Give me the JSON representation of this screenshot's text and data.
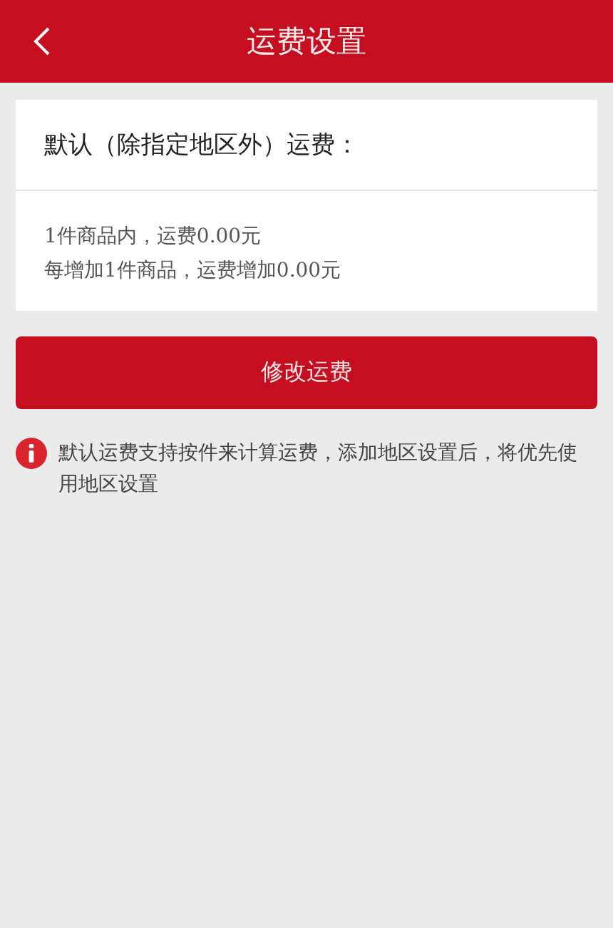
{
  "header": {
    "title": "运费设置"
  },
  "card": {
    "heading": "默认（除指定地区外）运费：",
    "lines": [
      "1件商品内，运费0.00元",
      "每增加1件商品，运费增加0.00元"
    ]
  },
  "button": "修改运费",
  "notice": "默认运费支持按件来计算运费，添加地区设置后，将优先使用地区设置"
}
